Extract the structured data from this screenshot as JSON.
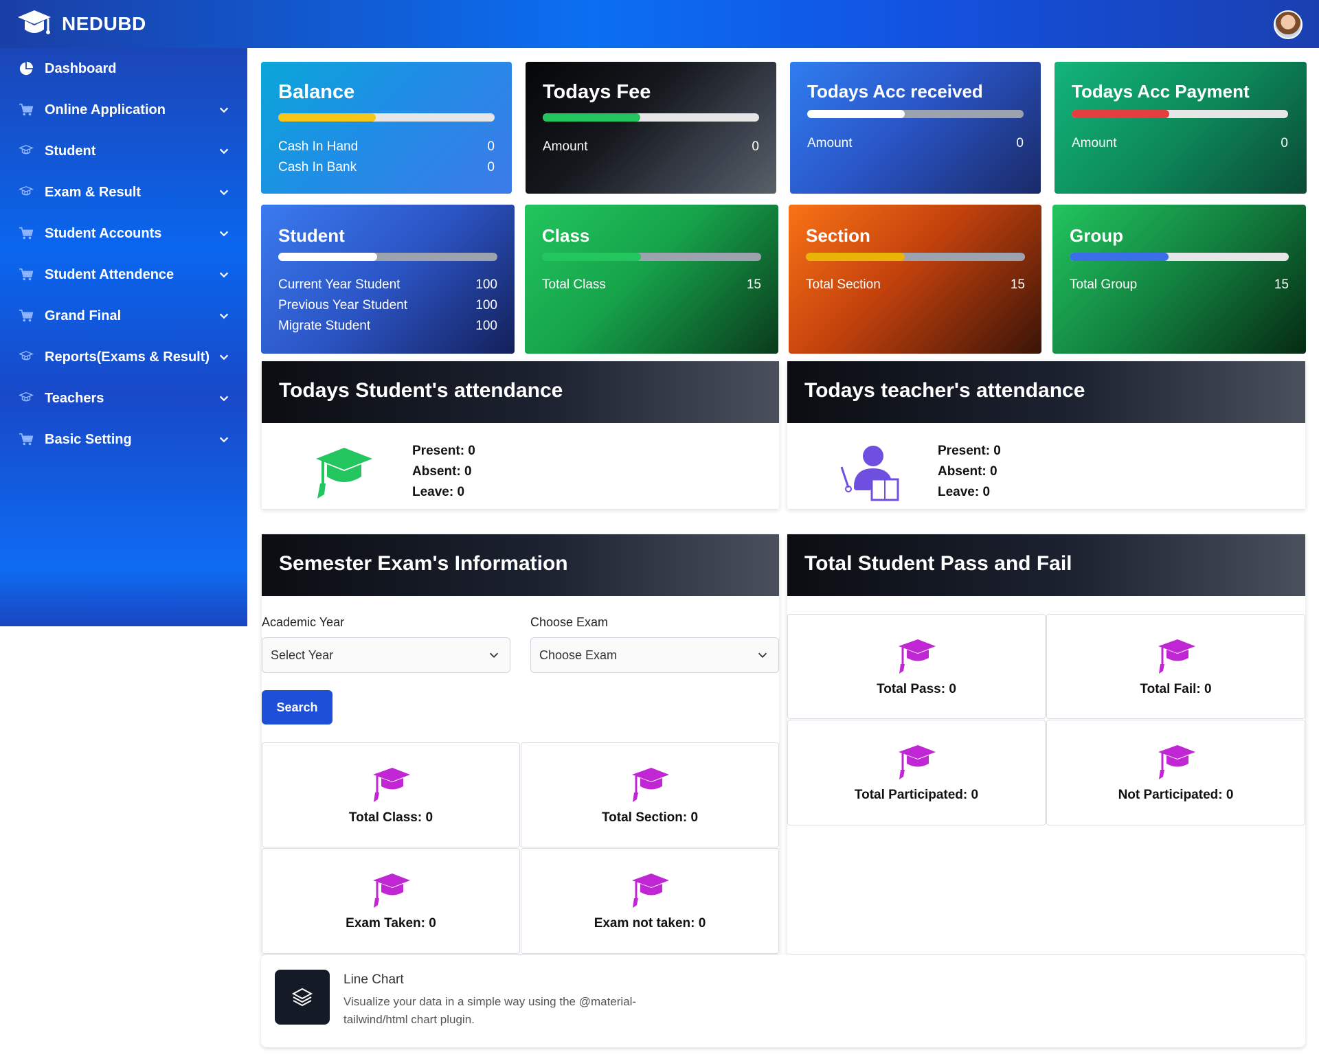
{
  "app": {
    "title": "NEDUBD"
  },
  "sidebar": {
    "items": [
      {
        "label": "Dashboard",
        "icon": "pie-chart-icon"
      },
      {
        "label": "Online Application",
        "icon": "cart-icon"
      },
      {
        "label": "Student",
        "icon": "student-icon"
      },
      {
        "label": "Exam & Result",
        "icon": "student-icon"
      },
      {
        "label": "Student Accounts",
        "icon": "cart-icon"
      },
      {
        "label": "Student Attendence",
        "icon": "cart-icon"
      },
      {
        "label": "Grand Final",
        "icon": "cart-icon"
      },
      {
        "label": "Reports(Exams & Result)",
        "icon": "student-icon"
      },
      {
        "label": "Teachers",
        "icon": "student-icon"
      },
      {
        "label": "Basic Setting",
        "icon": "cart-icon"
      }
    ]
  },
  "cards": {
    "balance": {
      "title": "Balance",
      "progress": 0.45,
      "rows": [
        {
          "label": "Cash In Hand",
          "value": "0"
        },
        {
          "label": "Cash In Bank",
          "value": "0"
        }
      ]
    },
    "todays_fee": {
      "title": "Todays Fee",
      "progress": 0.45,
      "rows": [
        {
          "label": "Amount",
          "value": "0"
        }
      ]
    },
    "acc_received": {
      "title": "Todays Acc received",
      "progress": 0.45,
      "rows": [
        {
          "label": "Amount",
          "value": "0"
        }
      ]
    },
    "acc_payment": {
      "title": "Todays Acc Payment",
      "progress": 0.45,
      "rows": [
        {
          "label": "Amount",
          "value": "0"
        }
      ]
    },
    "student": {
      "title": "Student",
      "progress": 0.45,
      "rows": [
        {
          "label": "Current Year Student",
          "value": "100"
        },
        {
          "label": "Previous Year Student",
          "value": "100"
        },
        {
          "label": "Migrate Student",
          "value": "100"
        }
      ]
    },
    "class": {
      "title": "Class",
      "progress": 0.45,
      "rows": [
        {
          "label": "Total Class",
          "value": "15"
        }
      ]
    },
    "section": {
      "title": "Section",
      "progress": 0.45,
      "rows": [
        {
          "label": "Total Section",
          "value": "15"
        }
      ]
    },
    "group": {
      "title": "Group",
      "progress": 0.45,
      "rows": [
        {
          "label": "Total Group",
          "value": "15"
        }
      ]
    }
  },
  "student_attendance": {
    "title": "Todays Student's attendance",
    "present": "Present: 0",
    "absent": "Absent: 0",
    "leave": "Leave: 0"
  },
  "teacher_attendance": {
    "title": "Todays teacher's attendance",
    "present": "Present: 0",
    "absent": "Absent: 0",
    "leave": "Leave: 0"
  },
  "semester": {
    "title": "Semester Exam's Information",
    "academic_year_label": "Academic Year",
    "academic_year_value": "Select Year",
    "choose_exam_label": "Choose Exam",
    "choose_exam_value": "Choose Exam",
    "search_label": "Search",
    "tiles": [
      "Total Class: 0",
      "Total Section: 0",
      "Exam Taken: 0",
      "Exam not taken: 0"
    ]
  },
  "pass_fail": {
    "title": "Total Student Pass and Fail",
    "tiles": [
      "Total Pass: 0",
      "Total Fail: 0",
      "Total Participated: 0",
      "Not Participated: 0"
    ]
  },
  "line_chart": {
    "title": "Line Chart",
    "description": "Visualize your data in a simple way using the @material-tailwind/html chart plugin."
  },
  "colors": {
    "accent": "#1d4fd8",
    "balance_bar": "#f5c518",
    "fee_bar": "#22c55e",
    "payment_bar": "#e53e3e",
    "class_bar": "#22c55e",
    "section_bar": "#eab308",
    "group_bar": "#3b6fe8",
    "cap_icon": "#c026d3"
  }
}
